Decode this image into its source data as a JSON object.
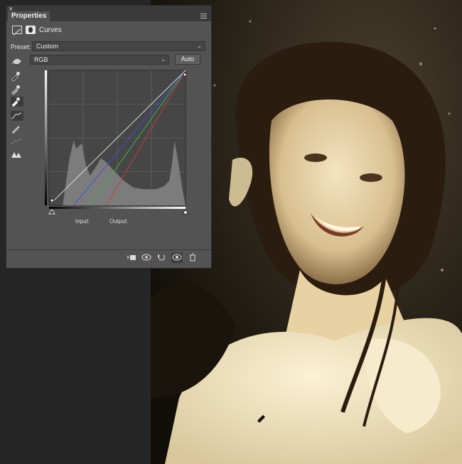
{
  "panel": {
    "tab_title": "Properties",
    "close_symbol": "×",
    "adjustment_title": "Curves",
    "preset_label": "Preset:",
    "preset_value": "Custom",
    "channel_value": "RGB",
    "auto_label": "Auto",
    "input_label": "Input:",
    "output_label": "Output:"
  },
  "tools": [
    "sample-black-point",
    "sample-gray-point",
    "sample-white-point",
    "curve-point-tool",
    "pencil-tool",
    "smooth-tool",
    "clipping-warning"
  ],
  "bottom_buttons": [
    "clip-to-layer",
    "view-previous",
    "reset",
    "toggle-visibility",
    "delete"
  ],
  "colors": {
    "panel_bg": "#535353",
    "curve_rgb": "#dcdcdc",
    "curve_red": "#c83c3c",
    "curve_green": "#3cb44a",
    "curve_blue": "#4050d0",
    "photo_tone": "#d9c9a0"
  }
}
